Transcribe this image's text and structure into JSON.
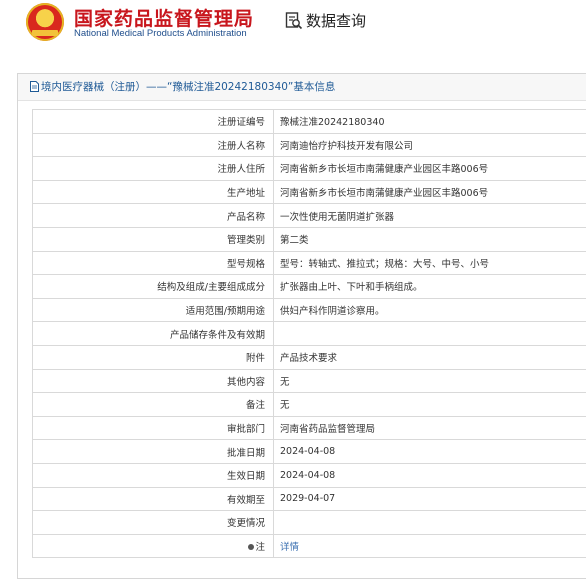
{
  "header": {
    "title_cn": "国家药品监督管理局",
    "title_en": "National Medical Products Administration",
    "query_label": "数据查询",
    "query_icon": "search-document-icon",
    "emblem_icon": "national-emblem-icon"
  },
  "panel": {
    "title": "境内医疗器械（注册）——“豫械注准20242180340”基本信息",
    "title_icon": "document-icon"
  },
  "rows": [
    {
      "label": "注册证编号",
      "value": "豫械注准20242180340"
    },
    {
      "label": "注册人名称",
      "value": "河南迪怡疗护科技开发有限公司"
    },
    {
      "label": "注册人住所",
      "value": "河南省新乡市长垣市南蒲健康产业园区丰路006号"
    },
    {
      "label": "生产地址",
      "value": "河南省新乡市长垣市南蒲健康产业园区丰路006号"
    },
    {
      "label": "产品名称",
      "value": "一次性使用无菌阴道扩张器"
    },
    {
      "label": "管理类别",
      "value": "第二类"
    },
    {
      "label": "型号规格",
      "value": "型号：转轴式、推拉式；规格：大号、中号、小号"
    },
    {
      "label": "结构及组成/主要组成成分",
      "value": "扩张器由上叶、下叶和手柄组成。"
    },
    {
      "label": "适用范围/预期用途",
      "value": "供妇产科作阴道诊察用。"
    },
    {
      "label": "产品储存条件及有效期",
      "value": ""
    },
    {
      "label": "附件",
      "value": "产品技术要求"
    },
    {
      "label": "其他内容",
      "value": "无"
    },
    {
      "label": "备注",
      "value": "无"
    },
    {
      "label": "审批部门",
      "value": "河南省药品监督管理局"
    },
    {
      "label": "批准日期",
      "value": "2024-04-08"
    },
    {
      "label": "生效日期",
      "value": "2024-04-08"
    },
    {
      "label": "有效期至",
      "value": "2029-04-07"
    },
    {
      "label": "变更情况",
      "value": ""
    },
    {
      "label": "注",
      "value": "详情",
      "icon": "pin-icon",
      "link": true
    }
  ]
}
